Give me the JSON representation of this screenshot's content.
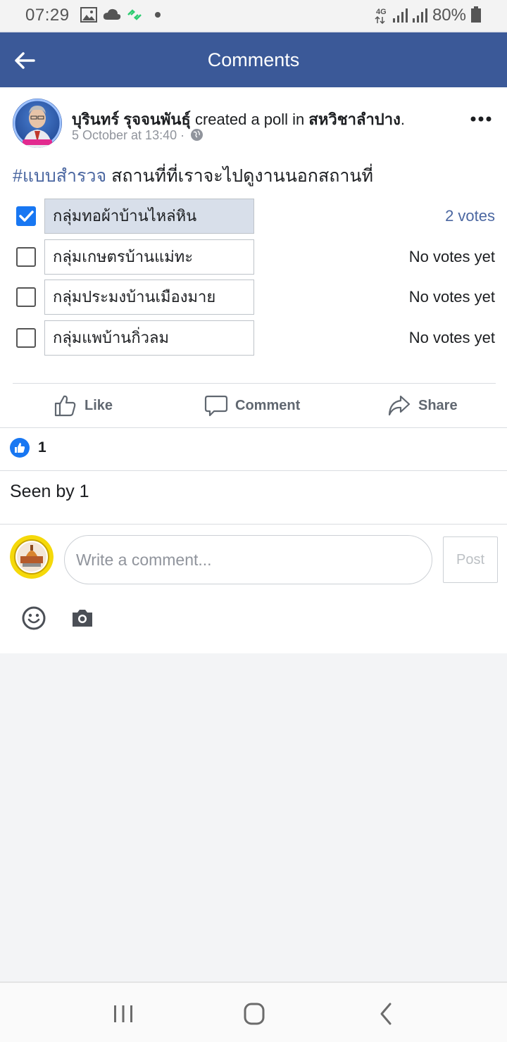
{
  "status_bar": {
    "time": "07:29",
    "network": "4G",
    "battery": "80%",
    "icons": [
      "image-icon",
      "cloud-icon",
      "sync-icon",
      "dot-icon",
      "signal-icon",
      "signal-icon",
      "battery-icon"
    ]
  },
  "header": {
    "title": "Comments",
    "back_icon": "arrow-left-icon"
  },
  "post": {
    "author": "บุรินทร์ รุจจนพันธุ์",
    "action": " created a poll in ",
    "group": "สหวิชาลำปาง",
    "group_suffix": ".",
    "timestamp": "5 October at 13:40 · ",
    "privacy_icon": "globe-icon",
    "more_icon": "more-horizontal-icon",
    "hashtag": "#แบบสำรวจ",
    "text": " สถานที่ที่เราจะไปดูงานนอกสถานที่",
    "poll": [
      {
        "label": "กลุ่มทอผ้าบ้านไหล่หิน",
        "votes": "2 votes",
        "checked": true
      },
      {
        "label": "กลุ่มเกษตรบ้านแม่ทะ",
        "votes": "No votes yet",
        "checked": false
      },
      {
        "label": "กลุ่มประมงบ้านเมืองมาย",
        "votes": "No votes yet",
        "checked": false
      },
      {
        "label": "กลุ่มแพบ้านกิ่วลม",
        "votes": "No votes yet",
        "checked": false
      }
    ],
    "actions": {
      "like": "Like",
      "comment": "Comment",
      "share": "Share"
    },
    "reaction_count": "1",
    "seen": "Seen by 1"
  },
  "composer": {
    "placeholder": "Write a comment...",
    "post_label": "Post"
  },
  "colors": {
    "brand": "#3b5998",
    "accent": "#1877f2",
    "link": "#4b67a1"
  }
}
